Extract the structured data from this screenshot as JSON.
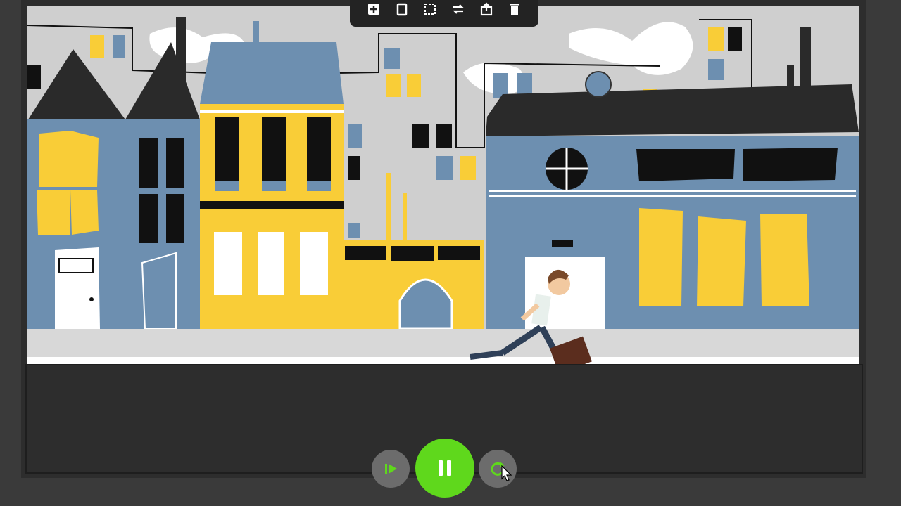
{
  "toolbar": {
    "tools": [
      {
        "icon": "add-scene-icon"
      },
      {
        "icon": "duplicate-icon"
      },
      {
        "icon": "select-area-icon"
      },
      {
        "icon": "swap-icon"
      },
      {
        "icon": "export-icon"
      },
      {
        "icon": "delete-icon"
      }
    ]
  },
  "playback": {
    "state": "playing",
    "buttons": [
      {
        "icon": "play-from-start-icon"
      },
      {
        "icon": "pause-icon"
      },
      {
        "icon": "replay-icon"
      }
    ]
  },
  "colors": {
    "accent": "#5fd81c",
    "building_blue": "#6d8fb0",
    "building_yellow": "#f9cd37",
    "sky": "#cfcfcf",
    "dark": "#2d2d2d"
  }
}
